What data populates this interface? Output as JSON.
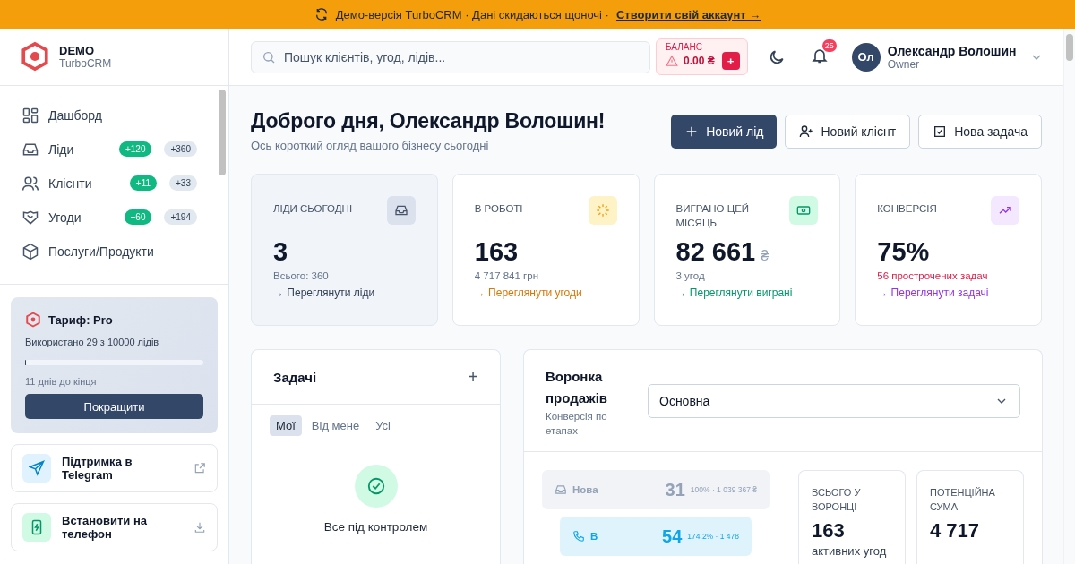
{
  "banner": {
    "text": "Демо-версія TurboCRM · Дані скидаються щоночі ·",
    "link": "Створити свій аккаунт →"
  },
  "sidebar": {
    "logo": {
      "title": "DEMO",
      "subtitle": "TurboCRM"
    },
    "nav": [
      {
        "label": "Дашборд",
        "kind": "grid",
        "selected": false
      },
      {
        "label": "Ліди",
        "kind": "inbox",
        "selected": false,
        "badges": [
          {
            "text": "+120",
            "kind": "new"
          },
          {
            "text": "+360",
            "kind": "total"
          }
        ]
      },
      {
        "label": "Клієнти",
        "kind": "users",
        "selected": false,
        "badges": [
          {
            "text": "+11",
            "kind": "new"
          },
          {
            "text": "+33",
            "kind": "total"
          }
        ]
      },
      {
        "label": "Угоди",
        "kind": "handshake",
        "selected": false,
        "badges": [
          {
            "text": "+60",
            "kind": "new"
          },
          {
            "text": "+194",
            "kind": "total"
          }
        ]
      },
      {
        "label": "Послуги/Продукти",
        "kind": "box",
        "selected": false
      }
    ],
    "plan": {
      "title": "Тариф: Pro",
      "usage": "Використано 29 з 10000 лідів",
      "level": 0.003,
      "remaining": "11 днів до кінця",
      "button": "Покращити"
    },
    "links": [
      {
        "title": "Підтримка в Telegram",
        "kind": "telegram"
      },
      {
        "title": "Встановити на телефон",
        "kind": "install"
      }
    ]
  },
  "header": {
    "search": {
      "placeholder": "Пошук клієнтів, угод, лідів..."
    },
    "balance": {
      "label": "БАЛАНС",
      "amount": "0.00 ₴",
      "add": "+"
    },
    "notifications": "25",
    "user": {
      "initials": "Ол",
      "name": "Олександр Волошин",
      "role": "Owner"
    }
  },
  "greeting": {
    "title": "Доброго дня, Олександр Волошин!",
    "subtitle": "Ось короткий огляд вашого бізнесу сьогодні"
  },
  "actions": [
    {
      "label": "Новий лід",
      "kind": "primary"
    },
    {
      "label": "Новий клієнт",
      "kind": "client"
    },
    {
      "label": "Нова задача",
      "kind": "task"
    }
  ],
  "stats": [
    {
      "label": "ЛІДИ СЬОГОДНІ",
      "value": "3",
      "detail": "Всього: 360",
      "alert": false,
      "link": "→ Переглянути ліди",
      "kind": "leads",
      "color": "#334155",
      "selected": true
    },
    {
      "label": "В РОБОТІ",
      "value": "163",
      "detail": "4 717 841 грн",
      "alert": false,
      "link": "→ Переглянути угоди",
      "kind": "deals",
      "color": "#d97706",
      "selected": false
    },
    {
      "label": "ВИГРАНО ЦЕЙ МІСЯЦЬ",
      "value": "82 661",
      "unit": "₴",
      "detail": "3 угод",
      "alert": false,
      "link": "→ Переглянути виграні",
      "kind": "won",
      "color": "#059669",
      "selected": false
    },
    {
      "label": "КОНВЕРСІЯ",
      "value": "75%",
      "detail": "56 прострочених задач",
      "alert": true,
      "link": "→ Переглянути задачі",
      "kind": "conversion",
      "color": "#9333ea",
      "selected": false
    }
  ],
  "tasks": {
    "title": "Задачі",
    "add": "+",
    "tabs": [
      {
        "label": "Мої",
        "selected": true
      },
      {
        "label": "Від мене",
        "selected": false
      },
      {
        "label": "Усі",
        "selected": false
      }
    ],
    "empty": "Все під контролем"
  },
  "funnel": {
    "title": "Воронка продажів",
    "subtitle": "Конверсія по етапах",
    "select": "Основна",
    "stages": [
      {
        "name": "Нова",
        "count": "31",
        "detail": "100% · 1 039 367 ₴",
        "kind": "inbox",
        "color": "#94a3b8"
      },
      {
        "name": "В",
        "count": "54",
        "detail": "174.2% · 1 478",
        "kind": "phone",
        "color": "#0ea5e9"
      }
    ],
    "totals": [
      {
        "label": "ВСЬОГО У ВОРОНЦІ",
        "value": "163",
        "note": "активних угод"
      },
      {
        "label": "ПОТЕНЦІЙНА СУМА",
        "value": "4 717"
      }
    ]
  }
}
